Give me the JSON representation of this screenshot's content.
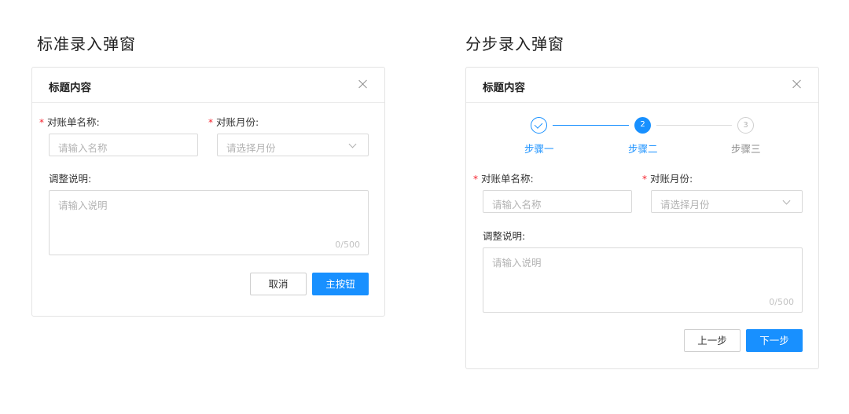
{
  "sections": {
    "standard_title": "标准录入弹窗",
    "stepped_title": "分步录入弹窗"
  },
  "standard_dialog": {
    "title": "标题内容",
    "fields": {
      "name_label": "对账单名称:",
      "name_placeholder": "请输入名称",
      "month_label": "对账月份:",
      "month_placeholder": "请选择月份",
      "note_label": "调整说明:",
      "note_placeholder": "请输入说明",
      "note_count": "0/500"
    },
    "required_mark": "*",
    "buttons": {
      "cancel": "取消",
      "primary": "主按钮"
    }
  },
  "stepped_dialog": {
    "title": "标题内容",
    "steps": [
      {
        "label": "步骤一",
        "status": "done"
      },
      {
        "label": "步骤二",
        "number": "2",
        "status": "active"
      },
      {
        "label": "步骤三",
        "number": "3",
        "status": "wait"
      }
    ],
    "fields": {
      "name_label": "对账单名称:",
      "name_placeholder": "请输入名称",
      "month_label": "对账月份:",
      "month_placeholder": "请选择月份",
      "note_label": "调整说明:",
      "note_placeholder": "请输入说明",
      "note_count": "0/500"
    },
    "required_mark": "*",
    "buttons": {
      "prev": "上一步",
      "next": "下一步"
    }
  },
  "colors": {
    "primary": "#1890ff",
    "required": "#f5222d",
    "border": "#d9d9d9",
    "placeholder": "#b3b3b3"
  },
  "icons": {
    "close": "close-icon",
    "dropdown": "chevron-down-icon",
    "step_done": "check-icon"
  }
}
